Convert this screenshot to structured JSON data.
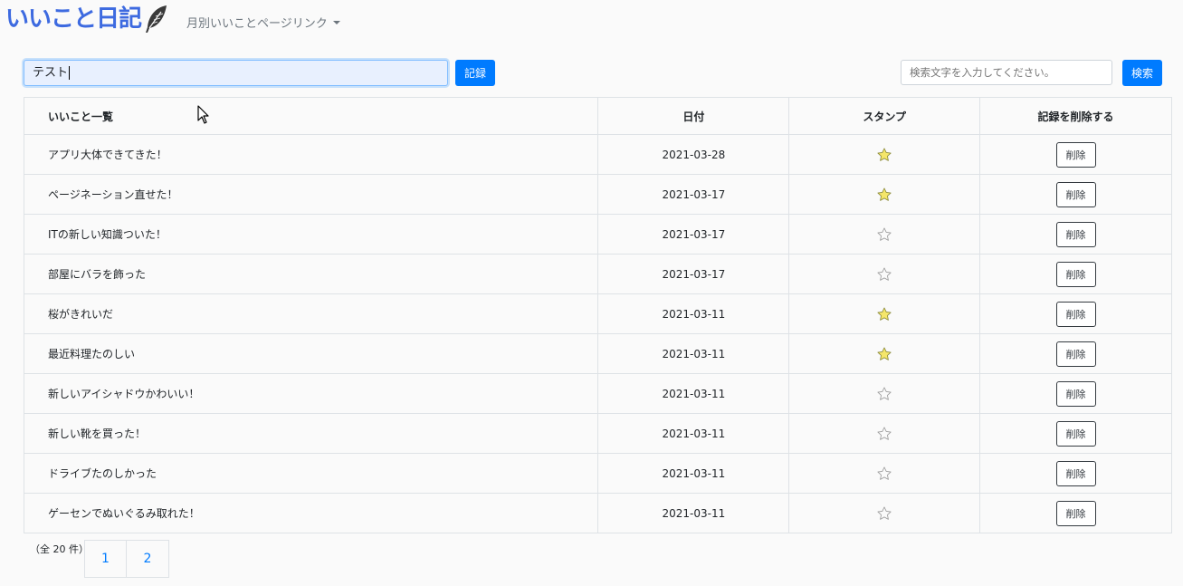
{
  "navbar": {
    "brand": "いいこと日記",
    "monthly_link": "月別いいことページリンク"
  },
  "form": {
    "memo_value": "テスト",
    "record_label": "記録",
    "search_placeholder": "検索文字を入力してください。",
    "search_label": "検索"
  },
  "table": {
    "headers": {
      "title": "いいこと一覧",
      "date": "日付",
      "stamp": "スタンプ",
      "delete": "記録を削除する"
    },
    "rows": [
      {
        "title": "アプリ大体できてきた！",
        "date": "2021-03-28",
        "stamp": true,
        "delete_label": "削除"
      },
      {
        "title": "ページネーション直せた！",
        "date": "2021-03-17",
        "stamp": true,
        "delete_label": "削除"
      },
      {
        "title": "ITの新しい知識ついた！",
        "date": "2021-03-17",
        "stamp": false,
        "delete_label": "削除"
      },
      {
        "title": "部屋にバラを飾った",
        "date": "2021-03-17",
        "stamp": false,
        "delete_label": "削除"
      },
      {
        "title": "桜がきれいだ",
        "date": "2021-03-11",
        "stamp": true,
        "delete_label": "削除"
      },
      {
        "title": "最近料理たのしい",
        "date": "2021-03-11",
        "stamp": true,
        "delete_label": "削除"
      },
      {
        "title": "新しいアイシャドウかわいい！",
        "date": "2021-03-11",
        "stamp": false,
        "delete_label": "削除"
      },
      {
        "title": "新しい靴を買った！",
        "date": "2021-03-11",
        "stamp": false,
        "delete_label": "削除"
      },
      {
        "title": "ドライブたのしかった",
        "date": "2021-03-11",
        "stamp": false,
        "delete_label": "削除"
      },
      {
        "title": "ゲーセンでぬいぐるみ取れた！",
        "date": "2021-03-11",
        "stamp": false,
        "delete_label": "削除"
      }
    ]
  },
  "pagination": {
    "total": "（全 20 件）",
    "pages": [
      "1",
      "2"
    ]
  },
  "icons": {
    "brand": "feather-icon",
    "stamp_on": "star-filled-icon",
    "stamp_off": "star-outline-icon",
    "dropdown": "caret-down-icon"
  },
  "colors": {
    "brand": "#3d6ae0",
    "primary": "#007bff",
    "star_fill": "#f5e66a"
  }
}
